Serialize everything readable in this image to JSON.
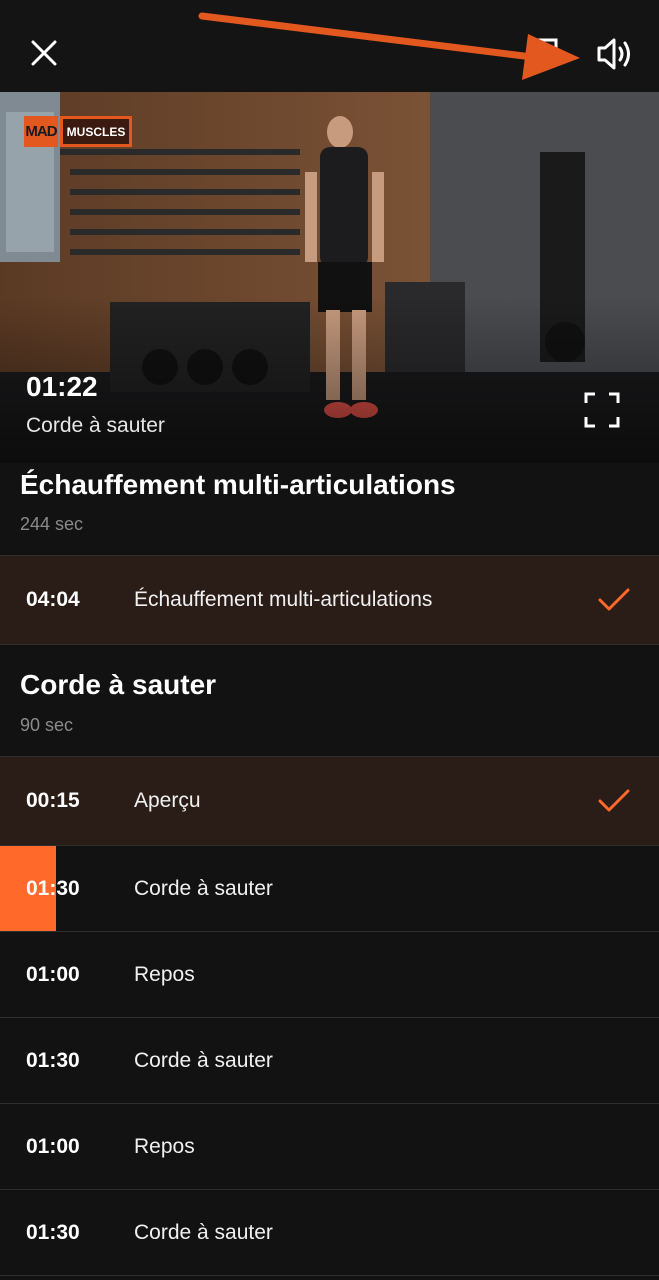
{
  "video": {
    "brand_left": "MAD",
    "brand_right": "MUSCLES",
    "current_time": "01:22",
    "current_exercise": "Corde à sauter"
  },
  "sections": [
    {
      "title": "Échauffement multi-articulations",
      "duration": "244 sec",
      "rows": [
        {
          "time": "04:04",
          "label": "Échauffement multi-articulations",
          "status": "done"
        }
      ]
    },
    {
      "title": "Corde à sauter",
      "duration": "90 sec",
      "rows": [
        {
          "time": "00:15",
          "label": "Aperçu",
          "status": "done"
        },
        {
          "time": "01:30",
          "label": "Corde à sauter",
          "status": "active",
          "progress": 0.085
        },
        {
          "time": "01:00",
          "label": "Repos",
          "status": "pending"
        },
        {
          "time": "01:30",
          "label": "Corde à sauter",
          "status": "pending"
        },
        {
          "time": "01:00",
          "label": "Repos",
          "status": "pending"
        },
        {
          "time": "01:30",
          "label": "Corde à sauter",
          "status": "pending"
        }
      ]
    }
  ],
  "icons": {
    "close": "close-icon",
    "cast": "cast-icon",
    "sound": "volume-icon",
    "fullscreen": "fullscreen-icon",
    "check": "checkmark-icon"
  },
  "colors": {
    "accent": "#ff6a2b",
    "annotation_arrow": "#e3581f",
    "done_row_bg": "#2a1d18",
    "background": "#121212"
  }
}
